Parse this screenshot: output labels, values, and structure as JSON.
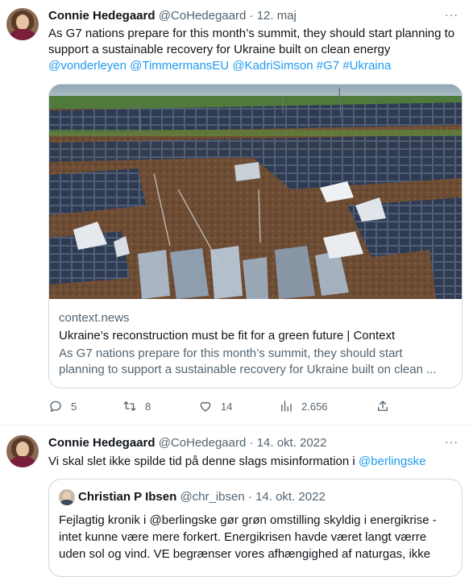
{
  "tweet1": {
    "name": "Connie Hedegaard",
    "handle": "@CoHedegaard",
    "sep": "·",
    "date": "12. maj",
    "more": "···",
    "text": "As G7 nations prepare for this month’s summit, they should start planning to support a sustainable recovery for Ukraine built on clean energy",
    "mentions": [
      "@vonderleyen",
      "@TimmermansEU",
      "@KadriSimson",
      "#G7",
      "#Ukraina"
    ],
    "card": {
      "domain": "context.news",
      "title": "Ukraine’s reconstruction must be fit for a green future | Context",
      "desc_line1": "As G7 nations prepare for this month’s summit, they should start",
      "desc_line2": "planning to support a sustainable recovery for Ukraine built on clean ..."
    },
    "actions": {
      "replies": "5",
      "retweets": "8",
      "likes": "14",
      "views": "2.656"
    }
  },
  "tweet2": {
    "name": "Connie Hedegaard",
    "handle": "@CoHedegaard",
    "sep": "·",
    "date": "14. okt. 2022",
    "more": "···",
    "text": "Vi skal slet ikke spilde tid på denne slags misinformation i",
    "mention": "@berlingske",
    "quote": {
      "name": "Christian P Ibsen",
      "handle": "@chr_ibsen",
      "sep": "·",
      "date": "14. okt. 2022",
      "line1": "Fejlagtig kronik i @berlingske gør grøn omstilling skyldig i energikrise -",
      "line2": "intet kunne være mere forkert. Energikrisen havde været langt værre",
      "line3": "uden sol og vind. VE begrænser vores afhængighed af naturgas, ikke"
    }
  },
  "colors": {
    "link": "#1d9bf0",
    "secondary": "#536471",
    "border": "#cfd9de"
  },
  "icons": [
    "reply-icon",
    "retweet-icon",
    "like-icon",
    "views-icon",
    "share-icon",
    "more-icon"
  ]
}
